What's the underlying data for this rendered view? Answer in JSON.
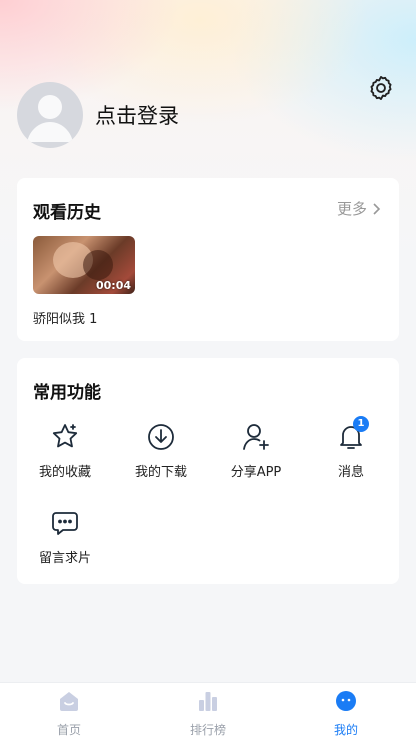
{
  "profile": {
    "login_text": "点击登录"
  },
  "history": {
    "title": "观看历史",
    "more_label": "更多",
    "items": [
      {
        "title": "骄阳似我 1",
        "duration": "00:04"
      }
    ]
  },
  "functions": {
    "title": "常用功能",
    "items": [
      {
        "label": "我的收藏",
        "icon": "star-icon"
      },
      {
        "label": "我的下载",
        "icon": "download-icon"
      },
      {
        "label": "分享APP",
        "icon": "add-user-icon"
      },
      {
        "label": "消息",
        "icon": "bell-icon",
        "badge": "1"
      },
      {
        "label": "留言求片",
        "icon": "message-icon"
      }
    ]
  },
  "tabbar": {
    "items": [
      {
        "label": "首页",
        "icon": "home-icon",
        "active": false
      },
      {
        "label": "排行榜",
        "icon": "ranking-icon",
        "active": false
      },
      {
        "label": "我的",
        "icon": "me-icon",
        "active": true
      }
    ]
  },
  "colors": {
    "accent": "#1a7cf5",
    "inactive": "#9aa0aa",
    "badge": "#1a7cf5"
  }
}
